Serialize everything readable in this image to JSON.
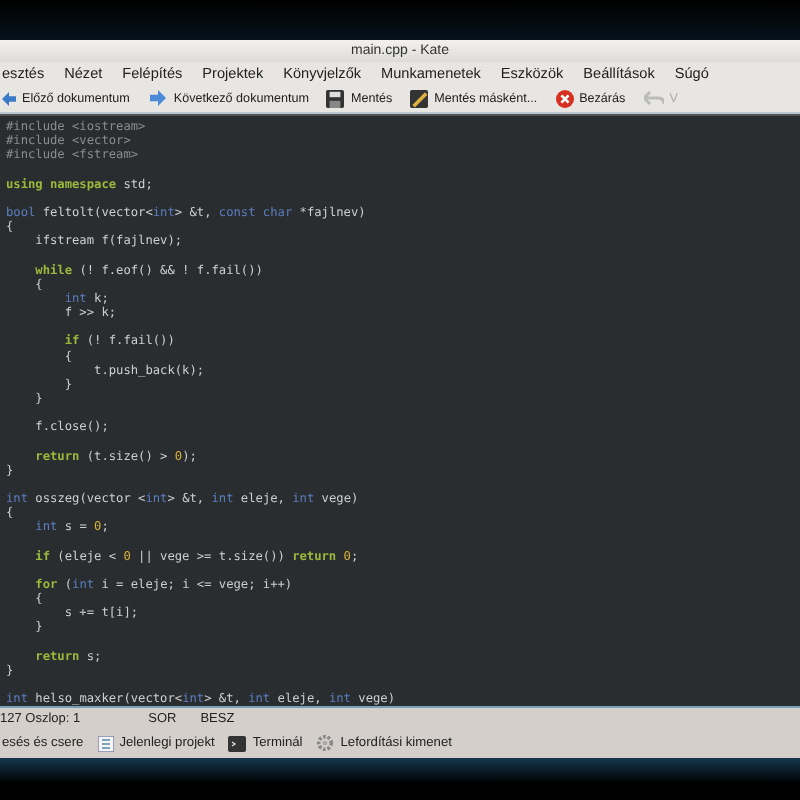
{
  "window": {
    "title": "main.cpp - Kate"
  },
  "menu": [
    "esztés",
    "Nézet",
    "Felépítés",
    "Projektek",
    "Könyvjelzők",
    "Munkamenetek",
    "Eszközök",
    "Beállítások",
    "Súgó"
  ],
  "toolbar": [
    {
      "kind": "prev",
      "label": "Előző dokumentum",
      "disabled": false
    },
    {
      "kind": "next",
      "label": "Következő dokumentum",
      "disabled": false
    },
    {
      "kind": "save",
      "label": "Mentés",
      "disabled": false
    },
    {
      "kind": "saveas",
      "label": "Mentés másként...",
      "disabled": false
    },
    {
      "kind": "close",
      "label": "Bezárás",
      "disabled": false
    },
    {
      "kind": "undo",
      "label": "V",
      "disabled": true
    }
  ],
  "code": [
    {
      "kind": "code",
      "segments": [
        {
          "t": "#include <iostream>",
          "kind": "preprocessor"
        }
      ]
    },
    {
      "kind": "code",
      "segments": [
        {
          "t": "#include <vector>",
          "kind": "preprocessor"
        }
      ]
    },
    {
      "kind": "code",
      "segments": [
        {
          "t": "#include <fstream>",
          "kind": "preprocessor"
        }
      ]
    },
    {
      "kind": "blank"
    },
    {
      "kind": "code",
      "segments": [
        {
          "t": "using namespace",
          "kind": "keyword"
        },
        {
          "t": " std;",
          "kind": "plain"
        }
      ]
    },
    {
      "kind": "blank"
    },
    {
      "kind": "code",
      "segments": [
        {
          "t": "bool",
          "kind": "type"
        },
        {
          "t": " feltolt(vector<",
          "kind": "plain"
        },
        {
          "t": "int",
          "kind": "type"
        },
        {
          "t": "> &t, ",
          "kind": "plain"
        },
        {
          "t": "const char",
          "kind": "type"
        },
        {
          "t": " *fajlnev)",
          "kind": "plain"
        }
      ]
    },
    {
      "kind": "code",
      "segments": [
        {
          "t": "{",
          "kind": "plain"
        }
      ]
    },
    {
      "kind": "code",
      "segments": [
        {
          "t": "    ifstream f(fajlnev);",
          "kind": "plain"
        }
      ]
    },
    {
      "kind": "blank"
    },
    {
      "kind": "code",
      "segments": [
        {
          "t": "    while",
          "kind": "keyword"
        },
        {
          "t": " (! f.eof() && ! f.fail())",
          "kind": "plain"
        }
      ]
    },
    {
      "kind": "code",
      "segments": [
        {
          "t": "    {",
          "kind": "plain"
        }
      ]
    },
    {
      "kind": "code",
      "segments": [
        {
          "t": "        int",
          "kind": "type"
        },
        {
          "t": " k;",
          "kind": "plain"
        }
      ]
    },
    {
      "kind": "code",
      "segments": [
        {
          "t": "        f >> k;",
          "kind": "plain"
        }
      ]
    },
    {
      "kind": "blank"
    },
    {
      "kind": "code",
      "segments": [
        {
          "t": "        if",
          "kind": "keyword"
        },
        {
          "t": " (! f.fail())",
          "kind": "plain"
        }
      ]
    },
    {
      "kind": "code",
      "segments": [
        {
          "t": "        {",
          "kind": "plain"
        }
      ]
    },
    {
      "kind": "code",
      "segments": [
        {
          "t": "            t.push_back(k);",
          "kind": "plain"
        }
      ]
    },
    {
      "kind": "code",
      "segments": [
        {
          "t": "        }",
          "kind": "plain"
        }
      ]
    },
    {
      "kind": "code",
      "segments": [
        {
          "t": "    }",
          "kind": "plain"
        }
      ]
    },
    {
      "kind": "blank"
    },
    {
      "kind": "code",
      "segments": [
        {
          "t": "    f.close();",
          "kind": "plain"
        }
      ]
    },
    {
      "kind": "blank"
    },
    {
      "kind": "code",
      "segments": [
        {
          "t": "    return",
          "kind": "keyword"
        },
        {
          "t": " (t.size() > ",
          "kind": "plain"
        },
        {
          "t": "0",
          "kind": "number"
        },
        {
          "t": ");",
          "kind": "plain"
        }
      ]
    },
    {
      "kind": "code",
      "segments": [
        {
          "t": "}",
          "kind": "plain"
        }
      ]
    },
    {
      "kind": "blank"
    },
    {
      "kind": "code",
      "segments": [
        {
          "t": "int",
          "kind": "type"
        },
        {
          "t": " osszeg(vector <",
          "kind": "plain"
        },
        {
          "t": "int",
          "kind": "type"
        },
        {
          "t": "> &t, ",
          "kind": "plain"
        },
        {
          "t": "int",
          "kind": "type"
        },
        {
          "t": " eleje, ",
          "kind": "plain"
        },
        {
          "t": "int",
          "kind": "type"
        },
        {
          "t": " vege)",
          "kind": "plain"
        }
      ]
    },
    {
      "kind": "code",
      "segments": [
        {
          "t": "{",
          "kind": "plain"
        }
      ]
    },
    {
      "kind": "code",
      "segments": [
        {
          "t": "    int",
          "kind": "type"
        },
        {
          "t": " s = ",
          "kind": "plain"
        },
        {
          "t": "0",
          "kind": "number"
        },
        {
          "t": ";",
          "kind": "plain"
        }
      ]
    },
    {
      "kind": "blank"
    },
    {
      "kind": "code",
      "segments": [
        {
          "t": "    if",
          "kind": "keyword"
        },
        {
          "t": " (eleje < ",
          "kind": "plain"
        },
        {
          "t": "0",
          "kind": "number"
        },
        {
          "t": " || vege >= t.size()) ",
          "kind": "plain"
        },
        {
          "t": "return",
          "kind": "keyword"
        },
        {
          "t": " 0",
          "kind": "number"
        },
        {
          "t": ";",
          "kind": "plain"
        }
      ]
    },
    {
      "kind": "blank"
    },
    {
      "kind": "code",
      "segments": [
        {
          "t": "    for",
          "kind": "keyword"
        },
        {
          "t": " (",
          "kind": "plain"
        },
        {
          "t": "int",
          "kind": "type"
        },
        {
          "t": " i = eleje; i <= vege; i++)",
          "kind": "plain"
        }
      ]
    },
    {
      "kind": "code",
      "segments": [
        {
          "t": "    {",
          "kind": "plain"
        }
      ]
    },
    {
      "kind": "code",
      "segments": [
        {
          "t": "        s += t[i];",
          "kind": "plain"
        }
      ]
    },
    {
      "kind": "code",
      "segments": [
        {
          "t": "    }",
          "kind": "plain"
        }
      ]
    },
    {
      "kind": "blank"
    },
    {
      "kind": "code",
      "segments": [
        {
          "t": "    return",
          "kind": "keyword"
        },
        {
          "t": " s;",
          "kind": "plain"
        }
      ]
    },
    {
      "kind": "code",
      "segments": [
        {
          "t": "}",
          "kind": "plain"
        }
      ]
    },
    {
      "kind": "blank"
    },
    {
      "kind": "code",
      "segments": [
        {
          "t": "int",
          "kind": "type"
        },
        {
          "t": " helso_maxker(vector<",
          "kind": "plain"
        },
        {
          "t": "int",
          "kind": "type"
        },
        {
          "t": "> &t, ",
          "kind": "plain"
        },
        {
          "t": "int",
          "kind": "type"
        },
        {
          "t": " eleje, ",
          "kind": "plain"
        },
        {
          "t": "int",
          "kind": "type"
        },
        {
          "t": " vege)",
          "kind": "plain"
        }
      ]
    }
  ],
  "status_bar": [
    "127 Oszlop: 1",
    "SOR",
    "BESZ"
  ],
  "bottom_tabs": [
    {
      "kind": "search",
      "label": "esés és csere"
    },
    {
      "kind": "project",
      "label": "Jelenlegi projekt"
    },
    {
      "kind": "terminal",
      "label": "Terminál"
    },
    {
      "kind": "build",
      "label": "Lefordítási kimenet"
    }
  ]
}
